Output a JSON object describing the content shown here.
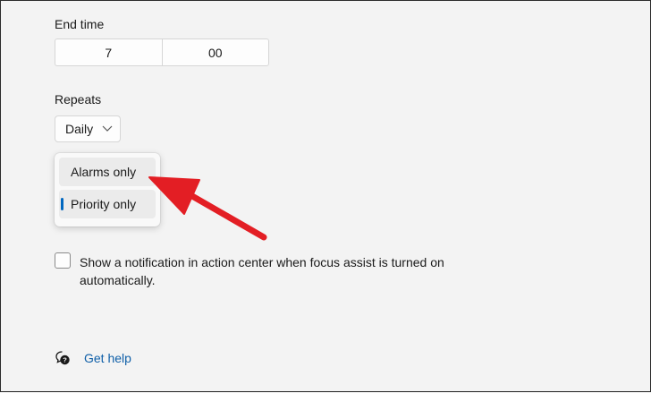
{
  "end_time": {
    "label": "End time",
    "hour": "7",
    "minute": "00"
  },
  "repeats": {
    "label": "Repeats",
    "selected": "Daily"
  },
  "dropdown_menu": {
    "items": [
      {
        "label": "Alarms only",
        "state": "hover"
      },
      {
        "label": "Priority only",
        "state": "selected"
      }
    ]
  },
  "notification_checkbox": {
    "label": "Show a notification in action center when focus assist is turned on automatically.",
    "checked": false
  },
  "help": {
    "label": "Get help",
    "icon": "help-chat-icon"
  },
  "annotation": {
    "arrow_color": "#e31e24"
  },
  "colors": {
    "accent": "#0067c0",
    "link": "#0f5fa8",
    "background": "#f3f3f3"
  }
}
